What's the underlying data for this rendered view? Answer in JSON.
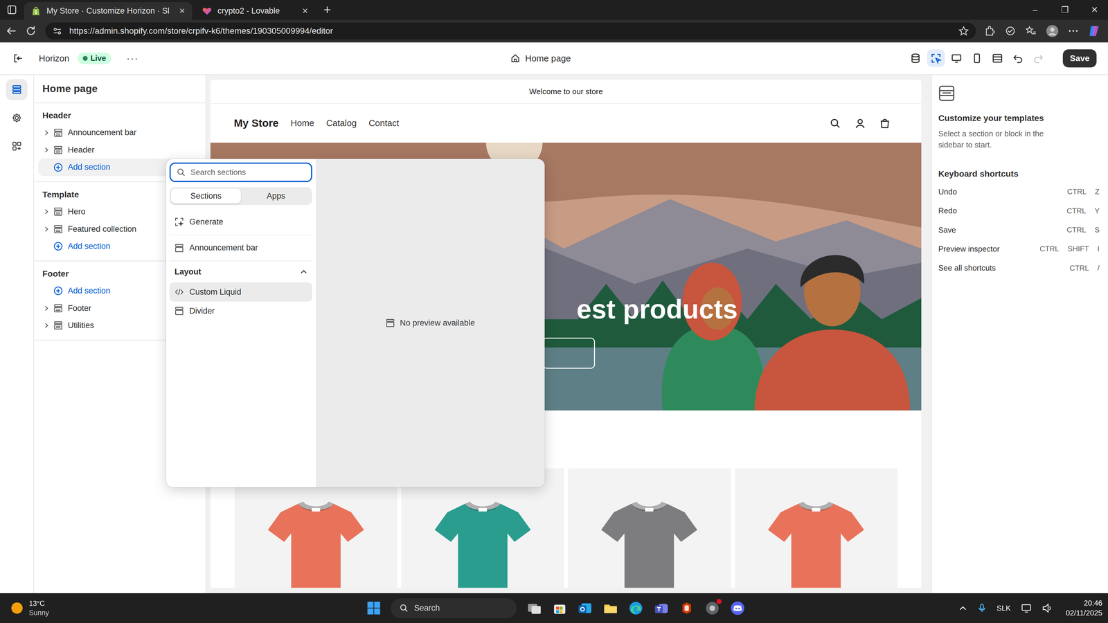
{
  "browser": {
    "tabs": [
      {
        "label": "My Store · Customize Horizon · Sl",
        "selected": true,
        "close": "×"
      },
      {
        "label": "crypto2 - Lovable",
        "selected": false,
        "close": "×"
      }
    ],
    "new_tab": "+",
    "window_controls": [
      "–",
      "❐",
      "✕"
    ],
    "url": "https://admin.shopify.com/store/crpifv-k6/themes/190305009994/editor"
  },
  "editor_bar": {
    "theme": "Horizon",
    "status": "Live",
    "more": "···",
    "page": "Home page",
    "save": "Save",
    "tools": [
      {
        "kind": "store",
        "selected": false,
        "disabled": false
      },
      {
        "kind": "inspector",
        "selected": true,
        "disabled": false
      },
      {
        "kind": "desktop",
        "selected": false,
        "disabled": false
      },
      {
        "kind": "mobile",
        "selected": false,
        "disabled": false
      },
      {
        "kind": "fullwidth",
        "selected": false,
        "disabled": false
      },
      {
        "kind": "undo",
        "selected": false,
        "disabled": false
      },
      {
        "kind": "redo",
        "selected": false,
        "disabled": true
      }
    ]
  },
  "rail": [
    {
      "kind": "sections",
      "selected": true
    },
    {
      "kind": "settings",
      "selected": false
    },
    {
      "kind": "apps",
      "selected": false
    }
  ],
  "sidebar": {
    "title": "Home page",
    "groups": [
      {
        "title": "Header",
        "items": [
          {
            "label": "Announcement bar",
            "kind": "section",
            "expanded": false,
            "highlighted": false
          },
          {
            "label": "Header",
            "kind": "section",
            "expanded": false,
            "highlighted": false
          },
          {
            "label": "Add section",
            "kind": "add",
            "expanded": false,
            "highlighted": true
          }
        ]
      },
      {
        "title": "Template",
        "items": [
          {
            "label": "Hero",
            "kind": "section",
            "expanded": false,
            "highlighted": false
          },
          {
            "label": "Featured collection",
            "kind": "section",
            "expanded": false,
            "highlighted": false
          },
          {
            "label": "Add section",
            "kind": "add",
            "expanded": false,
            "highlighted": false
          }
        ]
      },
      {
        "title": "Footer",
        "items": [
          {
            "label": "Add section",
            "kind": "add",
            "expanded": false,
            "highlighted": false
          },
          {
            "label": "Footer",
            "kind": "section",
            "expanded": false,
            "highlighted": false
          },
          {
            "label": "Utilities",
            "kind": "section",
            "expanded": false,
            "highlighted": false
          }
        ]
      }
    ]
  },
  "picker": {
    "placeholder": "Search sections",
    "tabs": [
      {
        "label": "Sections",
        "selected": true
      },
      {
        "label": "Apps",
        "selected": false
      }
    ],
    "items": [
      {
        "label": "Generate",
        "kind": "generate",
        "highlighted": false
      },
      {
        "label": "Announcement bar",
        "kind": "section",
        "highlighted": false
      }
    ],
    "group": {
      "label": "Layout",
      "expanded": true,
      "items": [
        {
          "label": "Custom Liquid",
          "kind": "code",
          "highlighted": true
        },
        {
          "label": "Divider",
          "kind": "section",
          "highlighted": false
        }
      ]
    },
    "preview": "No preview available"
  },
  "store": {
    "announcement": "Welcome to our store",
    "name": "My Store",
    "nav": [
      "Home",
      "Catalog",
      "Contact"
    ],
    "hero_heading": "est products",
    "products": [
      {
        "color": "#e8735a"
      },
      {
        "color": "#2a9d8f"
      },
      {
        "color": "#7d7d80"
      },
      {
        "color": "#e8735a"
      }
    ]
  },
  "right_panel": {
    "title": "Customize your templates",
    "description": "Select a section or block in the sidebar to start.",
    "shortcuts_title": "Keyboard shortcuts",
    "shortcuts": [
      {
        "label": "Undo",
        "keys": [
          "CTRL",
          "Z"
        ]
      },
      {
        "label": "Redo",
        "keys": [
          "CTRL",
          "Y"
        ]
      },
      {
        "label": "Save",
        "keys": [
          "CTRL",
          "S"
        ]
      },
      {
        "label": "Preview inspector",
        "keys": [
          "CTRL",
          "SHIFT",
          "I"
        ]
      },
      {
        "label": "See all shortcuts",
        "keys": [
          "CTRL",
          "/"
        ]
      }
    ]
  },
  "taskbar": {
    "temperature": "13°C",
    "weather": "Sunny",
    "search": "Search",
    "language": "SLK",
    "time": "20:46",
    "date": "02/11/2025"
  }
}
